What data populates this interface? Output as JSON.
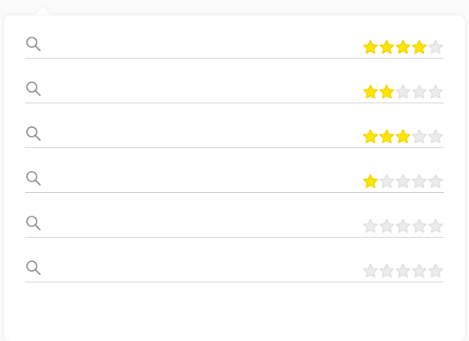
{
  "colors": {
    "star_filled": "#ffe600",
    "star_filled_stroke": "#f0d200",
    "star_empty": "#ececec",
    "star_empty_stroke": "#dedede",
    "divider": "#cfcfcf",
    "icon": "#8a8a8a"
  },
  "rows": [
    {
      "search": {
        "value": "",
        "icon": "search-icon"
      },
      "rating": {
        "value": 4,
        "max": 5
      }
    },
    {
      "search": {
        "value": "",
        "icon": "search-icon"
      },
      "rating": {
        "value": 2,
        "max": 5
      }
    },
    {
      "search": {
        "value": "",
        "icon": "search-icon"
      },
      "rating": {
        "value": 3,
        "max": 5
      }
    },
    {
      "search": {
        "value": "",
        "icon": "search-icon"
      },
      "rating": {
        "value": 1,
        "max": 5
      }
    },
    {
      "search": {
        "value": "",
        "icon": "search-icon"
      },
      "rating": {
        "value": 0,
        "max": 5
      }
    },
    {
      "search": {
        "value": "",
        "icon": "search-icon"
      },
      "rating": {
        "value": 0,
        "max": 5
      }
    }
  ]
}
